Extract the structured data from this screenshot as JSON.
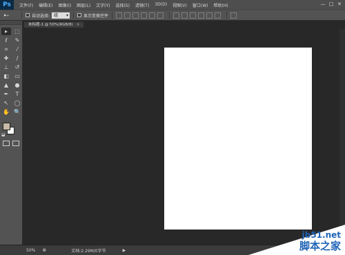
{
  "app": {
    "logo": "Ps"
  },
  "menu": {
    "items": [
      "文件(F)",
      "编辑(E)",
      "图像(I)",
      "图层(L)",
      "文字(Y)",
      "选择(S)",
      "滤镜(T)",
      "3D(D)",
      "视图(V)",
      "窗口(W)",
      "帮助(H)"
    ]
  },
  "window_controls": {
    "minimize": "—",
    "maximize": "□",
    "close": "✕"
  },
  "options": {
    "tool_preset_glyph": "▸₊",
    "auto_select_label": "自动选择:",
    "auto_select_value": "组",
    "show_transform_label": "显示变换控件"
  },
  "tools": [
    {
      "name": "move-tool",
      "glyph": "▸"
    },
    {
      "name": "marquee-tool",
      "glyph": "⬚"
    },
    {
      "name": "lasso-tool",
      "glyph": "ℓ"
    },
    {
      "name": "quick-select-tool",
      "glyph": "✎"
    },
    {
      "name": "crop-tool",
      "glyph": "⌗"
    },
    {
      "name": "eyedropper-tool",
      "glyph": "⁄"
    },
    {
      "name": "healing-tool",
      "glyph": "✚"
    },
    {
      "name": "brush-tool",
      "glyph": "∕"
    },
    {
      "name": "stamp-tool",
      "glyph": "⊥"
    },
    {
      "name": "history-brush-tool",
      "glyph": "↺"
    },
    {
      "name": "eraser-tool",
      "glyph": "◧"
    },
    {
      "name": "gradient-tool",
      "glyph": "▭"
    },
    {
      "name": "blur-tool",
      "glyph": "▲"
    },
    {
      "name": "dodge-tool",
      "glyph": "●"
    },
    {
      "name": "pen-tool",
      "glyph": "✒"
    },
    {
      "name": "type-tool",
      "glyph": "T"
    },
    {
      "name": "path-select-tool",
      "glyph": "↖"
    },
    {
      "name": "shape-tool",
      "glyph": "◯"
    },
    {
      "name": "hand-tool",
      "glyph": "✋"
    },
    {
      "name": "zoom-tool",
      "glyph": "🔍"
    }
  ],
  "swatch": {
    "default_icon": "⬓"
  },
  "document": {
    "tab_title": "未标题-1 @ 50%(RGB/8)",
    "tab_close": "×"
  },
  "status": {
    "zoom": "50%",
    "icon": "⊗",
    "doc_info": "文档:2.29M/0字节",
    "arrow": "▶"
  },
  "watermark": {
    "url": "jb51.net",
    "name": "脚本之家"
  },
  "colors": {
    "menubar": "#4e4e4e",
    "optionsbar": "#535353",
    "canvas_bg": "#282828",
    "page": "#ffffff",
    "foreground_color": "#c7b9a4",
    "background_color": "#ffffff",
    "logo_bg": "#0b2a45",
    "logo_fg": "#4fb0ff",
    "watermark_text": "#1e63b6"
  }
}
